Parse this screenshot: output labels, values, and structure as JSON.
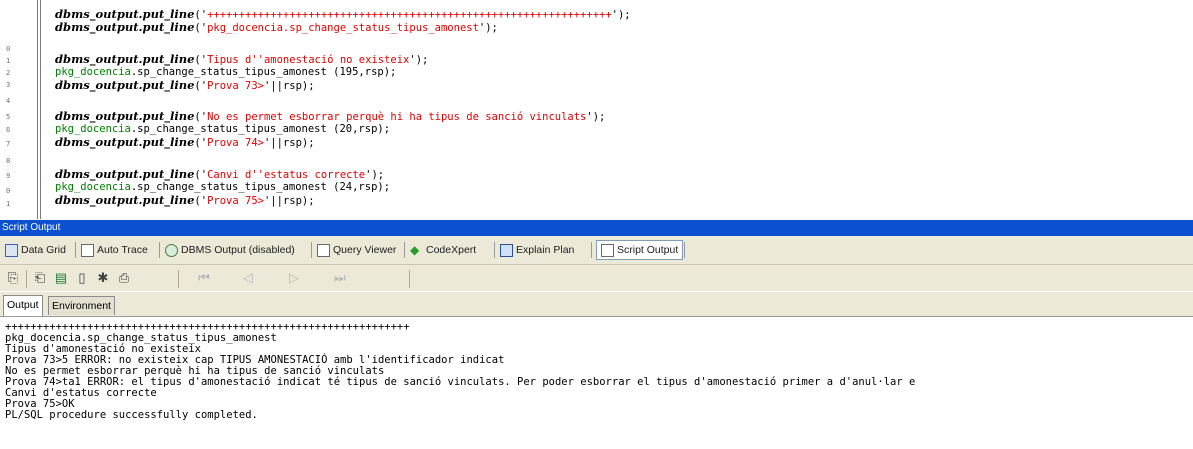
{
  "editor": {
    "line_numbers": [
      "0",
      "1",
      "2",
      "3",
      "4",
      "5",
      "6",
      "7",
      "8",
      "9",
      "0",
      "1"
    ],
    "lines": [
      {
        "kw": "dbms_output.put_line",
        "rest_a": "('",
        "str": "++++++++++++++++++++++++++++++++++++++++++++++++++++++++++++++++",
        "rest_b": "');",
        "pkg": "",
        "plain": ""
      },
      {
        "kw": "dbms_output.put_line",
        "rest_a": "('",
        "str": "pkg_docencia.sp_change_status_tipus_amonest",
        "rest_b": "');",
        "pkg": "",
        "plain": ""
      },
      {
        "kw": "dbms_output.put_line",
        "rest_a": "('",
        "str": "Tipus d''amonestació no existeix",
        "rest_b": "');",
        "pkg": "",
        "plain": ""
      },
      {
        "kw": "",
        "rest_a": "",
        "str": "",
        "rest_b": "",
        "pkg": "pkg_docencia",
        "plain": ".sp_change_status_tipus_amonest (195,rsp);"
      },
      {
        "kw": "dbms_output.put_line",
        "rest_a": "('",
        "str": "Prova 73>",
        "rest_b": "'||rsp);",
        "pkg": "",
        "plain": ""
      },
      {
        "kw": "dbms_output.put_line",
        "rest_a": "('",
        "str": "No es permet esborrar perquè hi ha tipus de sanció vinculats",
        "rest_b": "');",
        "pkg": "",
        "plain": ""
      },
      {
        "kw": "",
        "rest_a": "",
        "str": "",
        "rest_b": "",
        "pkg": "pkg_docencia",
        "plain": ".sp_change_status_tipus_amonest (20,rsp);"
      },
      {
        "kw": "dbms_output.put_line",
        "rest_a": "('",
        "str": "Prova 74>",
        "rest_b": "'||rsp);",
        "pkg": "",
        "plain": ""
      },
      {
        "kw": "dbms_output.put_line",
        "rest_a": "('",
        "str": "Canvi d''estatus correcte",
        "rest_b": "');",
        "pkg": "",
        "plain": ""
      },
      {
        "kw": "",
        "rest_a": "",
        "str": "",
        "rest_b": "",
        "pkg": "pkg_docencia",
        "plain": ".sp_change_status_tipus_amonest (24,rsp);"
      },
      {
        "kw": "dbms_output.put_line",
        "rest_a": "('",
        "str": "Prova 75>",
        "rest_b": "'||rsp);",
        "pkg": "",
        "plain": ""
      }
    ]
  },
  "panel": {
    "title": "Script Output",
    "tabs": [
      {
        "label": "Data Grid",
        "icon": "grid-icon"
      },
      {
        "label": "Auto Trace",
        "icon": "document-icon"
      },
      {
        "label": "DBMS Output (disabled)",
        "icon": "dbms-icon"
      },
      {
        "label": "Query Viewer",
        "icon": "document-icon"
      },
      {
        "label": "CodeXpert",
        "icon": "codexpert-icon"
      },
      {
        "label": "Explain Plan",
        "icon": "explain-plan-icon"
      },
      {
        "label": "Script Output",
        "icon": "document-icon"
      }
    ],
    "toolbar": [
      {
        "name": "copy-icon",
        "glyph": "⎘"
      },
      {
        "name": "paste-icon",
        "glyph": "⎗"
      },
      {
        "name": "save-icon",
        "glyph": "▤"
      },
      {
        "name": "new-document-icon",
        "glyph": "▯"
      },
      {
        "name": "find-icon",
        "glyph": "✱"
      },
      {
        "name": "print-icon",
        "glyph": "⎙"
      },
      {
        "name": "first-page-icon",
        "glyph": "⏮"
      },
      {
        "name": "previous-page-icon",
        "glyph": "◁"
      },
      {
        "name": "next-page-icon",
        "glyph": "▷"
      },
      {
        "name": "last-page-icon",
        "glyph": "⏭"
      }
    ],
    "subtabs": {
      "output": "Output",
      "environment": "Environment"
    },
    "output_lines": [
      "++++++++++++++++++++++++++++++++++++++++++++++++++++++++++++++++",
      "pkg_docencia.sp_change_status_tipus_amonest",
      "Tipus d'amonestació no existeix",
      "Prova 73>5 ERROR: no existeix cap TIPUS AMONESTACIÓ amb l'identificador indicat",
      "No es permet esborrar perquè hi ha tipus de sanció vinculats",
      "Prova 74>ta1 ERROR: el tipus d'amonestació indicat té tipus de sanció vinculats. Per poder esborrar el tipus d'amonestació primer a d'anul·lar e",
      "Canvi d'estatus correcte",
      "Prova 75>OK",
      "PL/SQL procedure successfully completed."
    ]
  },
  "colors": {
    "title_bar": "#0a50d0",
    "string": "#e00000",
    "package": "#008000"
  }
}
